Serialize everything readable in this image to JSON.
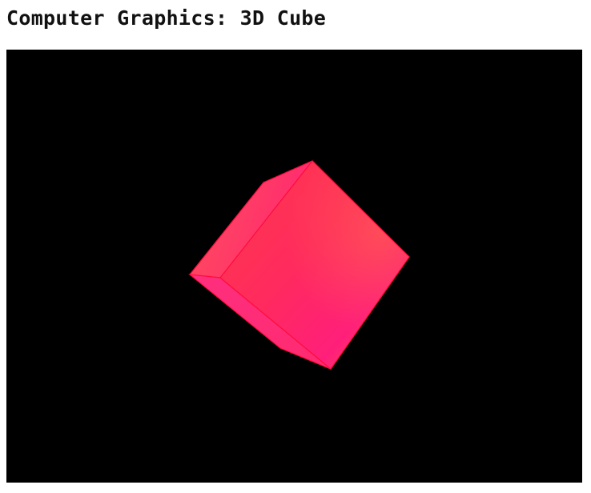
{
  "page": {
    "title": "Computer Graphics: 3D Cube"
  },
  "scene": {
    "background_color": "#000000",
    "object": "cube",
    "cube_colors": {
      "front_light": "#ff3b4a",
      "front_mid": "#ff2a5e",
      "front_pink": "#ff1f7a",
      "front_orange": "#ff5a4a",
      "left_light": "#ff4f5c",
      "left_dark": "#ff2a70",
      "bottom": "#ff2f7e",
      "edge": "#ff0a3c"
    }
  }
}
